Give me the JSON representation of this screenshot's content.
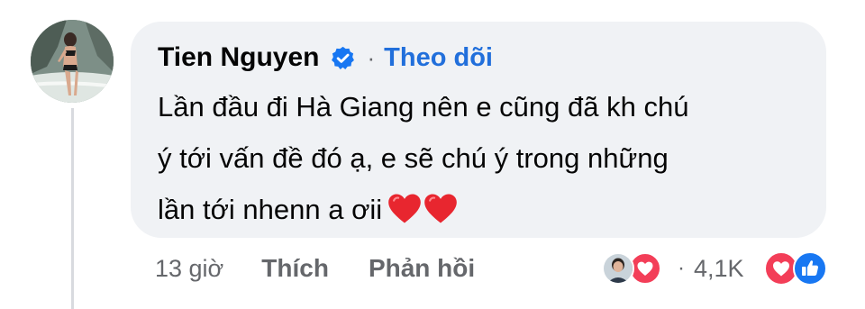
{
  "comment": {
    "author": "Tien Nguyen",
    "separator": "·",
    "follow_label": "Theo dõi",
    "text_lines": [
      "Lần đầu đi Hà Giang nên e cũng đã kh chú",
      "ý tới vấn đề đó ạ, e sẽ chú ý trong những",
      "lần tới nhenn a ơii"
    ],
    "emoji": [
      "red-heart-emoji",
      "red-heart-emoji"
    ]
  },
  "actions": {
    "time": "13 giờ",
    "like_label": "Thích",
    "reply_label": "Phản hồi"
  },
  "reactions": {
    "separator": "·",
    "count": "4,1K",
    "icons": [
      "love-reaction-icon",
      "like-reaction-icon"
    ]
  },
  "colors": {
    "bubble_bg": "#f0f2f5",
    "link_blue": "#216fdb",
    "secondary_text": "#65676b",
    "primary_text": "#050505",
    "love_red": "#f33e58",
    "like_blue": "#1877f2"
  }
}
